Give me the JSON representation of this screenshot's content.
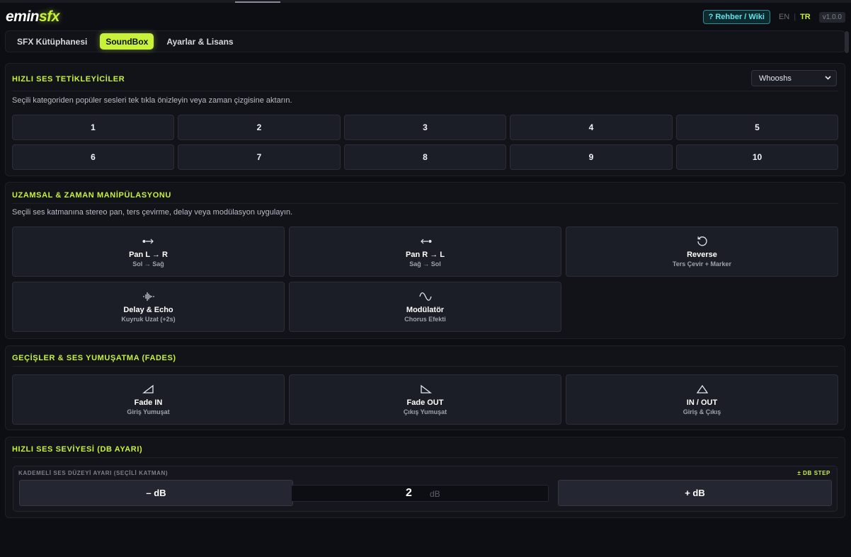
{
  "header": {
    "logo_part1": "emin",
    "logo_part2": "sfx",
    "wiki_label": "? Rehber / Wiki",
    "lang_en": "EN",
    "lang_sep": "|",
    "lang_tr": "TR",
    "version": "v1.0.0"
  },
  "tabs": [
    {
      "label": "SFX Kütüphanesi",
      "active": false
    },
    {
      "label": "SoundBox",
      "active": true
    },
    {
      "label": "Ayarlar & Lisans",
      "active": false
    }
  ],
  "quick_triggers": {
    "title": "HIZLI SES TETİKLEYİCİLER",
    "selected": "Whooshs",
    "description": "Seçili kategoriden popüler sesleri tek tıkla önizleyin veya zaman çizgisine aktarın.",
    "buttons": [
      "1",
      "2",
      "3",
      "4",
      "5",
      "6",
      "7",
      "8",
      "9",
      "10"
    ]
  },
  "spatial": {
    "title": "UZAMSAL & ZAMAN MANİPÜLASYONU",
    "description": "Seçili ses katmanına stereo pan, ters çevirme, delay veya modülasyon uygulayın.",
    "pan_lr": {
      "icon": "pan-right-icon",
      "title": "Pan L → R",
      "sub": "Sol → Sağ"
    },
    "pan_rl": {
      "icon": "pan-left-icon",
      "title": "Pan R → L",
      "sub": "Sağ → Sol"
    },
    "reverse": {
      "icon": "reverse-icon",
      "title": "Reverse",
      "sub": "Ters Çevir + Marker"
    },
    "delay": {
      "icon": "waveform-icon",
      "title": "Delay & Echo",
      "sub": "Kuyruk Uzat (+2s)"
    },
    "modulator": {
      "icon": "sine-wave-icon",
      "title": "Modülatör",
      "sub": "Chorus Efekti"
    }
  },
  "fades": {
    "title": "GEÇİŞLER & SES YUMUŞATMA (FADES)",
    "fade_in": {
      "icon": "fade-in-icon",
      "title": "Fade IN",
      "sub": "Giriş Yumuşat"
    },
    "fade_out": {
      "icon": "fade-out-icon",
      "title": "Fade OUT",
      "sub": "Çıkış Yumuşat"
    },
    "in_out": {
      "icon": "fade-in-out-icon",
      "title": "IN / OUT",
      "sub": "Giriş & Çıkış"
    }
  },
  "volume": {
    "title": "HIZLI SES SEVİYESİ (DB AYARI)",
    "box_label": "KADEMELİ SES DÜZEYİ AYARI (SEÇİLİ KATMAN)",
    "step_label": "± DB STEP",
    "minus_label": "– dB",
    "value": "2",
    "unit": "dB",
    "plus_label": "+ dB"
  },
  "colors": {
    "accent": "#c8f23a",
    "background": "#0d0e14",
    "panel": "#121319",
    "button": "#1c1e27",
    "wiki": "#5fe3ea"
  }
}
